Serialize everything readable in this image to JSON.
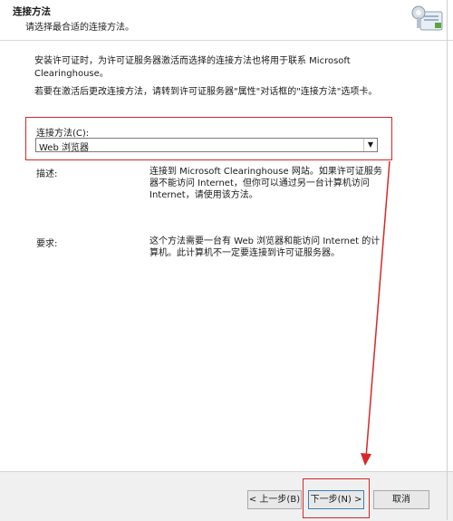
{
  "header": {
    "title": "连接方法",
    "subtitle": "请选择最合适的连接方法。"
  },
  "intro": {
    "line1": "安装许可证时，为许可证服务器激活而选择的连接方法也将用于联系 Microsoft Clearinghouse。",
    "line2": "若要在激活后更改连接方法，请转到许可证服务器\"属性\"对话框的\"连接方法\"选项卡。"
  },
  "connection_method": {
    "label": "连接方法(C):",
    "selected": "Web 浏览器"
  },
  "description": {
    "label": "描述:",
    "text": "连接到 Microsoft Clearinghouse 网站。如果许可证服务器不能访问 Internet，但你可以通过另一台计算机访问 Internet，请使用该方法。"
  },
  "requirements": {
    "label": "要求:",
    "text": "这个方法需要一台有 Web 浏览器和能访问 Internet 的计算机。此计算机不一定要连接到许可证服务器。"
  },
  "footer": {
    "back_label": "< 上一步(B)",
    "next_label": "下一步(N) >",
    "cancel_label": "取消"
  },
  "colors": {
    "annotation": "#d62828",
    "accent": "#3c7fb1"
  }
}
